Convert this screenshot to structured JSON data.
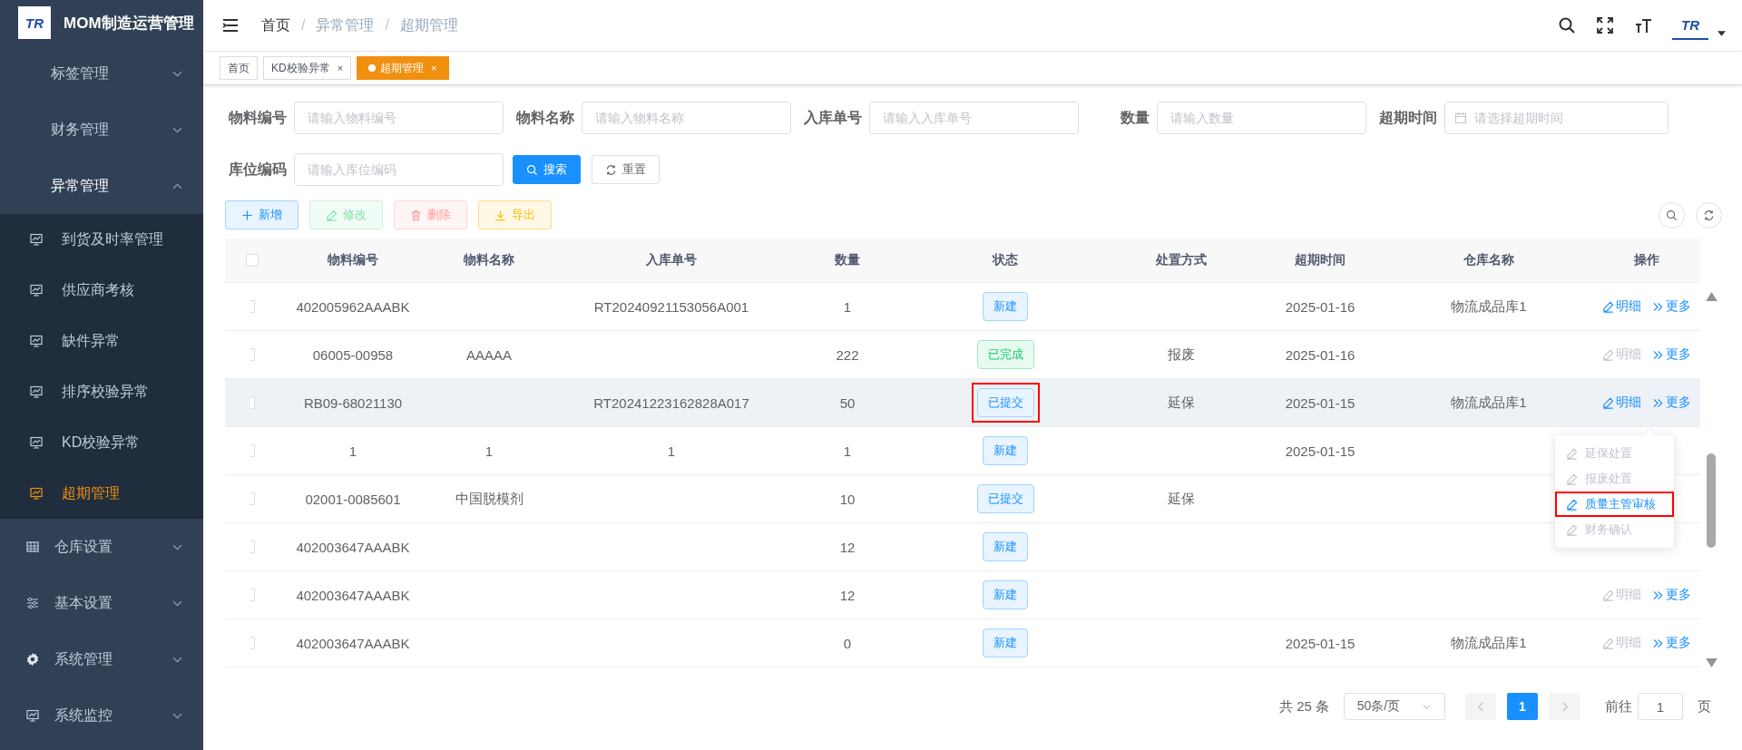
{
  "sidebar": {
    "title": "MOM制造运营管理",
    "logo_text": "TR",
    "menu": [
      {
        "label": "标签管理",
        "expanded": false
      },
      {
        "label": "财务管理",
        "expanded": false
      },
      {
        "label": "异常管理",
        "expanded": true,
        "children": [
          {
            "label": "到货及时率管理",
            "selected": false
          },
          {
            "label": "供应商考核",
            "selected": false
          },
          {
            "label": "缺件异常",
            "selected": false
          },
          {
            "label": "排序校验异常",
            "selected": false
          },
          {
            "label": "KD校验异常",
            "selected": false
          },
          {
            "label": "超期管理",
            "selected": true
          }
        ]
      },
      {
        "label": "仓库设置",
        "expanded": false
      },
      {
        "label": "基本设置",
        "expanded": false
      },
      {
        "label": "系统管理",
        "expanded": false
      },
      {
        "label": "系统监控",
        "expanded": false
      }
    ]
  },
  "header": {
    "breadcrumb": [
      "首页",
      "异常管理",
      "超期管理"
    ],
    "separator": "/",
    "avatar_text": "TR"
  },
  "tabs": [
    {
      "label": "首页",
      "closable": false,
      "selected": false
    },
    {
      "label": "KD校验异常",
      "closable": true,
      "selected": false
    },
    {
      "label": "超期管理",
      "closable": true,
      "selected": true
    }
  ],
  "tab_close": "×",
  "filters": [
    {
      "label": "物料编号",
      "placeholder": "请输入物料编号",
      "kind": "text"
    },
    {
      "label": "物料名称",
      "placeholder": "请输入物料名称",
      "kind": "text"
    },
    {
      "label": "入库单号",
      "placeholder": "请输入入库单号",
      "kind": "text"
    },
    {
      "label": "数量",
      "placeholder": "请输入数量",
      "kind": "text"
    },
    {
      "label": "超期时间",
      "placeholder": "请选择超期时间",
      "kind": "date"
    },
    {
      "label": "库位编码",
      "placeholder": "请输入库位编码",
      "kind": "text"
    }
  ],
  "search_button": "搜索",
  "reset_button": "重置",
  "toolbar": [
    {
      "label": "新增",
      "kind": "add",
      "disabled": false
    },
    {
      "label": "修改",
      "kind": "edit",
      "disabled": true
    },
    {
      "label": "删除",
      "kind": "delete",
      "disabled": true
    },
    {
      "label": "导出",
      "kind": "export",
      "disabled": false
    }
  ],
  "table": {
    "columns": [
      "物料编号",
      "物料名称",
      "入库单号",
      "数量",
      "状态",
      "处置方式",
      "超期时间",
      "仓库名称",
      "操作"
    ],
    "all_checked": false,
    "rows": [
      {
        "checked": false,
        "hover": false,
        "code": "402005962AAABK",
        "receipt": "RT20240921153056A001",
        "qty": "1",
        "status": {
          "label": "新建",
          "kind": "primary",
          "highlighted": false
        },
        "due": "2025-01-16",
        "warehouse": "物流成品库1",
        "detail": {
          "label": "明细",
          "disabled": false
        },
        "more": "更多"
      },
      {
        "checked": false,
        "hover": false,
        "code": "06005-00958",
        "name": "AAAAA",
        "qty": "222",
        "status": {
          "label": "已完成",
          "kind": "success",
          "highlighted": false
        },
        "disposal": "报废",
        "due": "2025-01-16",
        "detail": {
          "label": "明细",
          "disabled": true
        },
        "more": "更多"
      },
      {
        "checked": false,
        "hover": true,
        "code": "RB09-68021130",
        "receipt": "RT20241223162828A017",
        "qty": "50",
        "status": {
          "label": "已提交",
          "kind": "primary",
          "highlighted": true
        },
        "disposal": "延保",
        "due": "2025-01-15",
        "warehouse": "物流成品库1",
        "detail": {
          "label": "明细",
          "disabled": false
        },
        "more": "更多"
      },
      {
        "checked": false,
        "hover": false,
        "code": "1",
        "name": "1",
        "receipt": "1",
        "qty": "1",
        "status": {
          "label": "新建",
          "kind": "primary",
          "highlighted": false
        },
        "due": "2025-01-15"
      },
      {
        "checked": false,
        "hover": false,
        "code": "02001-0085601",
        "name": "中国脱模剂",
        "qty": "10",
        "status": {
          "label": "已提交",
          "kind": "primary",
          "highlighted": false
        },
        "disposal": "延保"
      },
      {
        "checked": false,
        "hover": false,
        "code": "402003647AAABK",
        "qty": "12",
        "status": {
          "label": "新建",
          "kind": "primary",
          "highlighted": false
        }
      },
      {
        "checked": false,
        "hover": false,
        "code": "402003647AAABK",
        "qty": "12",
        "status": {
          "label": "新建",
          "kind": "primary",
          "highlighted": false
        },
        "detail": {
          "label": "明细",
          "disabled": true
        },
        "more": "更多"
      },
      {
        "checked": false,
        "hover": false,
        "code": "402003647AAABK",
        "qty": "0",
        "status": {
          "label": "新建",
          "kind": "primary",
          "highlighted": false
        },
        "due": "2025-01-15",
        "warehouse": "物流成品库1",
        "detail": {
          "label": "明细",
          "disabled": true
        },
        "more": "更多"
      }
    ]
  },
  "dropdown": {
    "items": [
      {
        "label": "延保处置",
        "disabled": true,
        "highlighted": false
      },
      {
        "label": "报废处置",
        "disabled": true,
        "highlighted": false
      },
      {
        "label": "质量主管审核",
        "disabled": false,
        "highlighted": true
      },
      {
        "label": "财务确认",
        "disabled": true,
        "highlighted": false
      }
    ]
  },
  "pagination": {
    "total": "共 25 条",
    "page_size": "50条/页",
    "pages": [
      {
        "label": "1",
        "selected": true
      }
    ],
    "goto": "前往",
    "goto_value": "1",
    "suffix": "页"
  }
}
